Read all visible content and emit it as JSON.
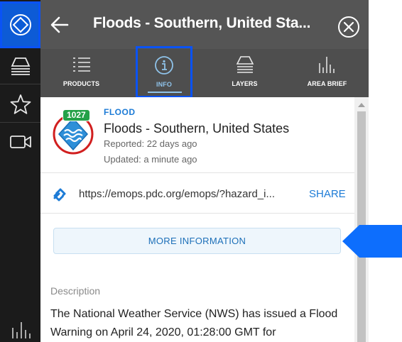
{
  "header": {
    "title": "Floods - Southern, United Sta..."
  },
  "tabs": [
    {
      "label": "PRODUCTS",
      "icon": "list-icon"
    },
    {
      "label": "INFO",
      "icon": "info-icon",
      "selected": true
    },
    {
      "label": "LAYERS",
      "icon": "layers-icon"
    },
    {
      "label": "AREA BRIEF",
      "icon": "bar-chart-icon"
    }
  ],
  "rail": {
    "items": [
      "home-diamond-icon",
      "layers-icon",
      "star-icon",
      "video-camera-icon",
      "bar-chart-icon"
    ]
  },
  "hazard": {
    "count": "1027",
    "type": "FLOOD",
    "name": "Floods - Southern, United States",
    "reported": "Reported: 22 days ago",
    "updated": "Updated: a minute ago"
  },
  "link": {
    "url": "https://emops.pdc.org/emops/?hazard_i...",
    "share": "SHARE"
  },
  "more_info": "MORE INFORMATION",
  "description": {
    "label": "Description",
    "text": "The National Weather Service (NWS) has issued a Flood Warning on April 24, 2020, 01:28:00 GMT for"
  },
  "colors": {
    "rail": "#1b1b1b",
    "header": "#555555",
    "tabs": "#4e4e4e",
    "accent": "#1c7bd6",
    "highlight": "#0a53f5",
    "badge": "#24a148"
  }
}
